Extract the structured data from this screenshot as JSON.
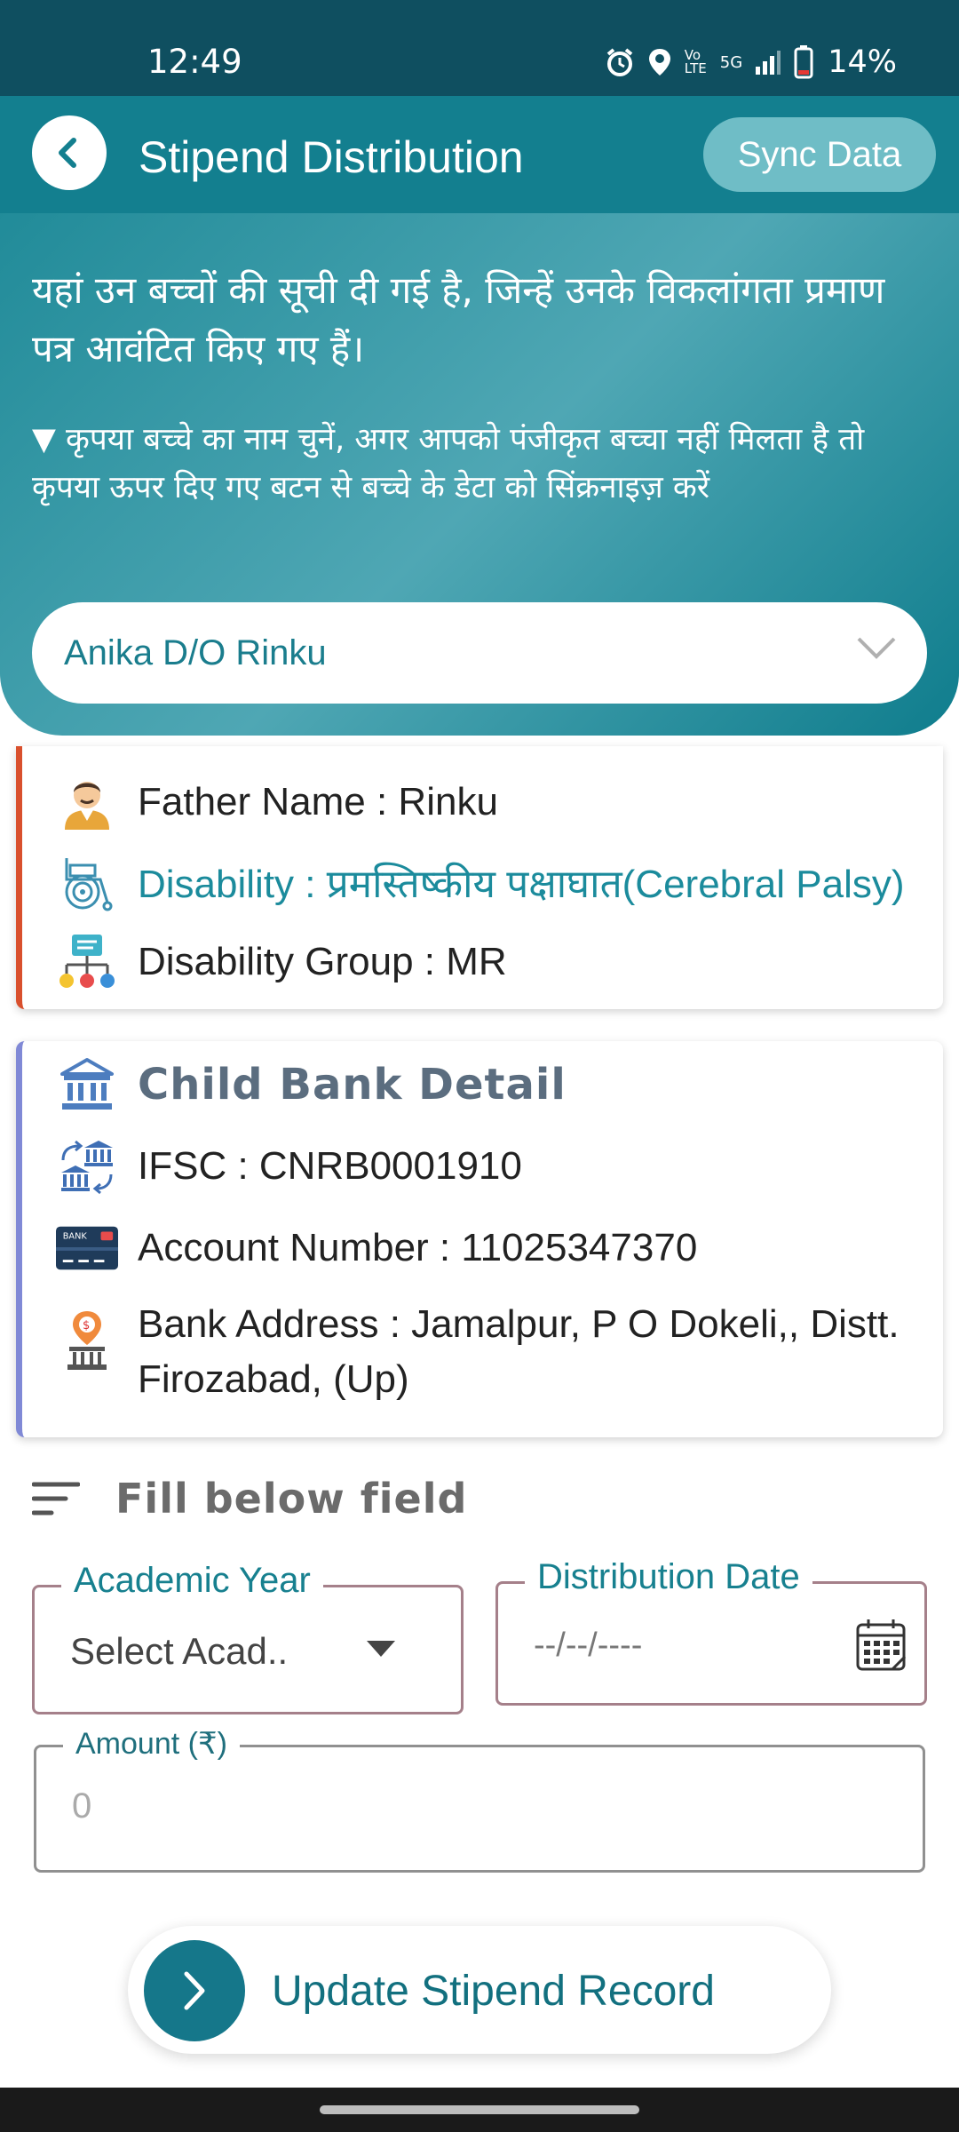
{
  "status_bar": {
    "time": "12:49",
    "network": "5G",
    "volte": "Vo LTE",
    "battery": "14%"
  },
  "header": {
    "title": "Stipend Distribution",
    "sync_label": "Sync Data",
    "description": "यहां उन बच्चों की सूची दी गई है, जिन्हें उनके विकलांगता प्रमाण पत्र आवंटित किए गए हैं।",
    "note": "▼ कृपया बच्चे का नाम चुनें, अगर आपको पंजीकृत बच्चा नहीं मिलता है तो कृपया ऊपर दिए गए बटन से बच्चे के डेटा को सिंक्रनाइज़ करें",
    "selected_child": "Anika D/O Rinku"
  },
  "child_details": {
    "father_name": "Father Name : Rinku",
    "disability": "Disability : प्रमस्तिष्कीय पक्षाघात(Cerebral Palsy)",
    "disability_group": "Disability Group : MR"
  },
  "bank_detail": {
    "title": "Child Bank Detail",
    "ifsc": "IFSC : CNRB0001910",
    "account_number": "Account Number : 11025347370",
    "bank_address": "Bank Address : Jamalpur, P O Dokeli,, Distt. Firozabad, (Up)",
    "card_badge": "BANK"
  },
  "form": {
    "section_label": "Fill below field",
    "academic_year_label": "Academic Year",
    "academic_year_value": "Select Acad..",
    "distribution_date_label": "Distribution Date",
    "distribution_date_value": "--/--/----",
    "amount_label": "Amount (₹)",
    "amount_placeholder": "0"
  },
  "actions": {
    "update_label": "Update Stipend Record"
  },
  "colors": {
    "primary": "#137f8f",
    "accent_red": "#d9502d",
    "accent_purple": "#8089d6"
  }
}
